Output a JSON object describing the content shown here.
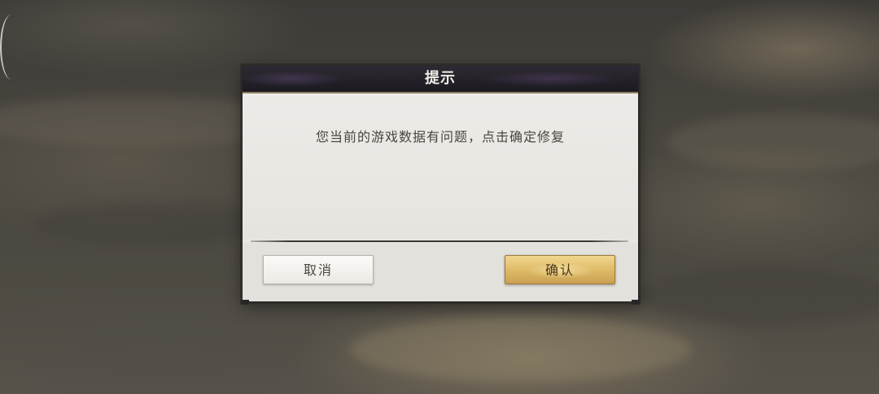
{
  "dialog": {
    "title": "提示",
    "message": "您当前的游戏数据有问题，点击确定修复",
    "cancel_label": "取消",
    "confirm_label": "确认"
  },
  "colors": {
    "header_bg": "#1c1a20",
    "panel_bg": "#e9e7e2",
    "confirm_gold": "#ddb965",
    "cancel_white": "#f5f4f0",
    "text_dark": "#4a4640"
  }
}
